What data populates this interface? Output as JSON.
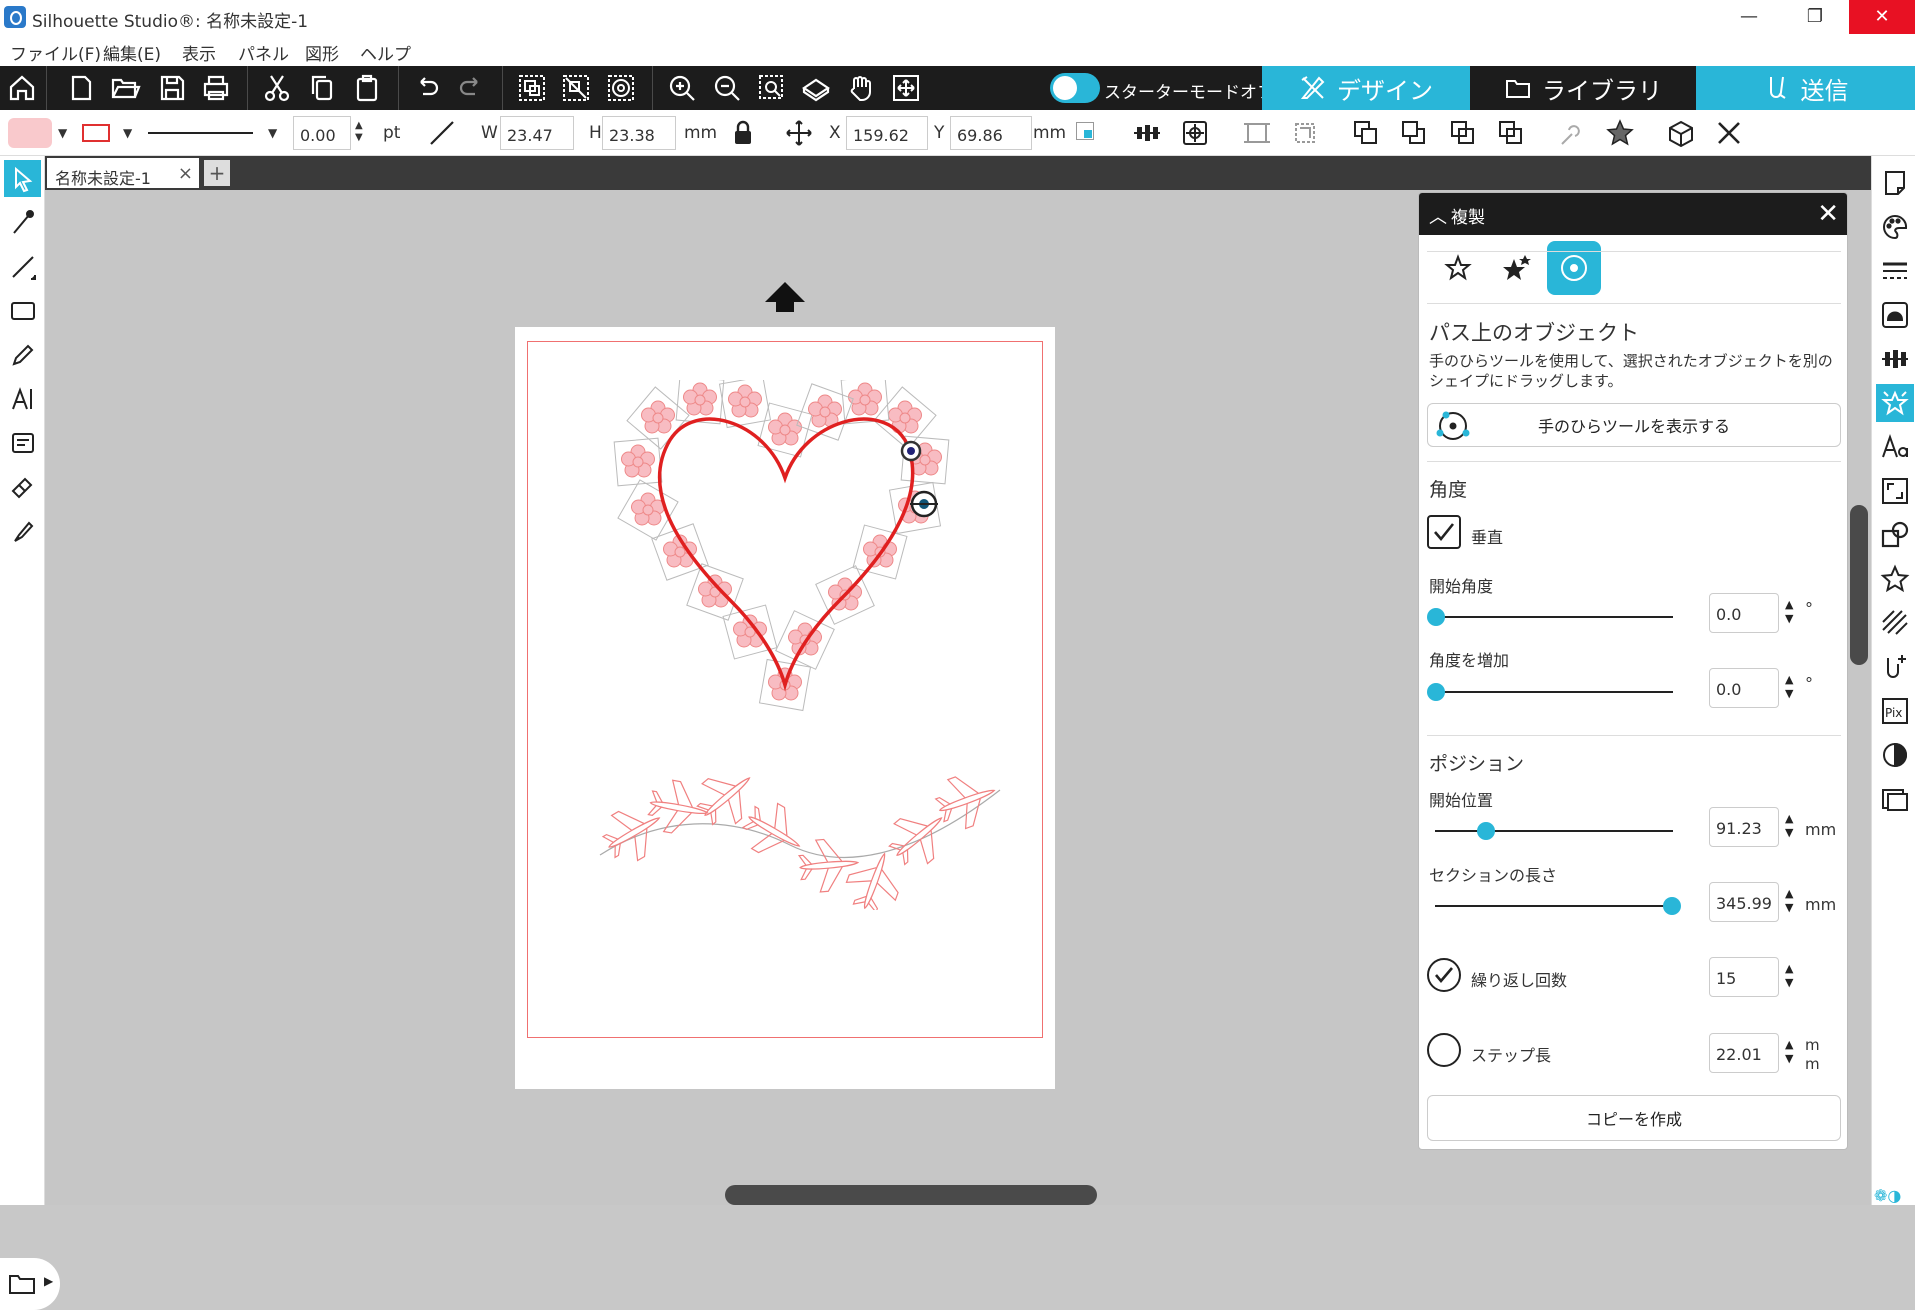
{
  "window": {
    "title": "Silhouette Studio®: 名称未設定-1",
    "min_icon": "minimize-icon",
    "max_icon": "restore-icon",
    "close_icon": "close-icon"
  },
  "menu": [
    "ファイル(F)",
    "編集(E)",
    "表示",
    "パネル",
    "図形",
    "ヘルプ"
  ],
  "toolbar": {
    "starter_mode_label": "スターターモードオフ",
    "tabs": {
      "design": "デザイン",
      "library": "ライブラリ",
      "send": "送信"
    },
    "accent": "#29b6d8"
  },
  "properties": {
    "line_width": "0.00",
    "line_unit": "pt",
    "w_label": "W",
    "w_value": "23.47",
    "h_label": "H",
    "h_value": "23.38",
    "size_unit": "mm",
    "x_label": "X",
    "x_value": "159.62",
    "y_label": "Y",
    "y_value": "69.86",
    "pos_unit": "mm",
    "fill_color": "#f9c9cc",
    "stroke_color": "#e03030"
  },
  "document": {
    "tab_label": "名称未設定-1",
    "tab_close": "×",
    "add_tab": "+"
  },
  "panel": {
    "title": "複製",
    "close": "✕",
    "section_title": "パス上のオブジェクト",
    "description": "手のひらツールを使用して、選択されたオブジェクトを別のシェイプにドラッグします。",
    "show_hand_tool_button": "手のひらツールを表示する",
    "angle_heading": "角度",
    "vertical_label": "垂直",
    "vertical_checked": true,
    "start_angle_label": "開始角度",
    "start_angle_value": "0.0",
    "start_angle_fraction": 0.0,
    "angle_increment_label": "角度を増加",
    "angle_increment_value": "0.0",
    "angle_increment_fraction": 0.0,
    "degree_unit": "°",
    "position_heading": "ポジション",
    "start_position_label": "開始位置",
    "start_position_value": "91.23",
    "start_position_fraction": 0.21,
    "section_length_label": "セクションの長さ",
    "section_length_value": "345.99",
    "section_length_fraction": 1.0,
    "mm_unit": "mm",
    "repeat_count_label": "繰り返し回数",
    "repeat_count_checked": true,
    "repeat_count_value": "15",
    "step_length_label": "ステップ長",
    "step_length_checked": false,
    "step_length_value": "22.01",
    "step_unit_line1": "m",
    "step_unit_line2": "m",
    "make_copy_button": "コピーを作成"
  }
}
